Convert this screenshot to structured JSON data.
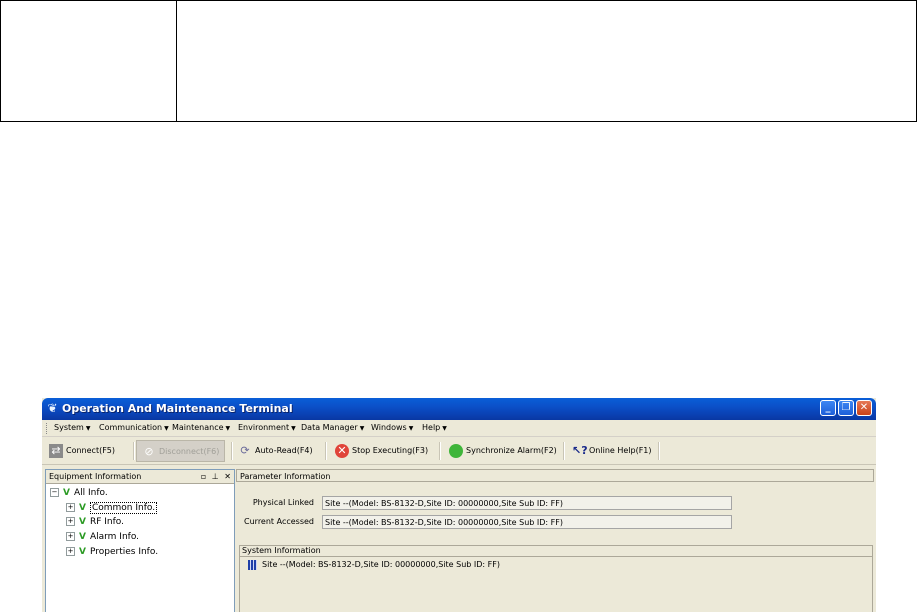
{
  "window": {
    "title": "Operation And Maintenance Terminal",
    "controls": {
      "minimize": "_",
      "maximize": "❐",
      "close": "✕"
    }
  },
  "menu": [
    {
      "label": "System"
    },
    {
      "label": "Communication"
    },
    {
      "label": "Maintenance"
    },
    {
      "label": "Environment"
    },
    {
      "label": "Data Manager"
    },
    {
      "label": "Windows"
    },
    {
      "label": "Help"
    }
  ],
  "toolbar": {
    "connect": "Connect(F5)",
    "disconnect": "Disconnect(F6)",
    "auto_read": "Auto-Read(F4)",
    "stop": "Stop Executing(F3)",
    "sync": "Synchronize Alarm(F2)",
    "help": "Online Help(F1)"
  },
  "equipment": {
    "header": "Equipment Information",
    "tree": {
      "root": "All Info.",
      "children": [
        "Common Info.",
        "RF Info.",
        "Alarm Info.",
        "Properties Info."
      ]
    }
  },
  "parameter": {
    "header": "Parameter Information",
    "physical_label": "Physical Linked",
    "physical_value": "Site --(Model: BS-8132-D,Site ID: 00000000,Site Sub ID: FF)",
    "current_label": "Current Accessed",
    "current_value": "Site --(Model: BS-8132-D,Site ID: 00000000,Site Sub ID: FF)"
  },
  "system_info": {
    "header": "System Information",
    "site": "Site --(Model: BS-8132-D,Site ID: 00000000,Site Sub ID: FF)"
  }
}
